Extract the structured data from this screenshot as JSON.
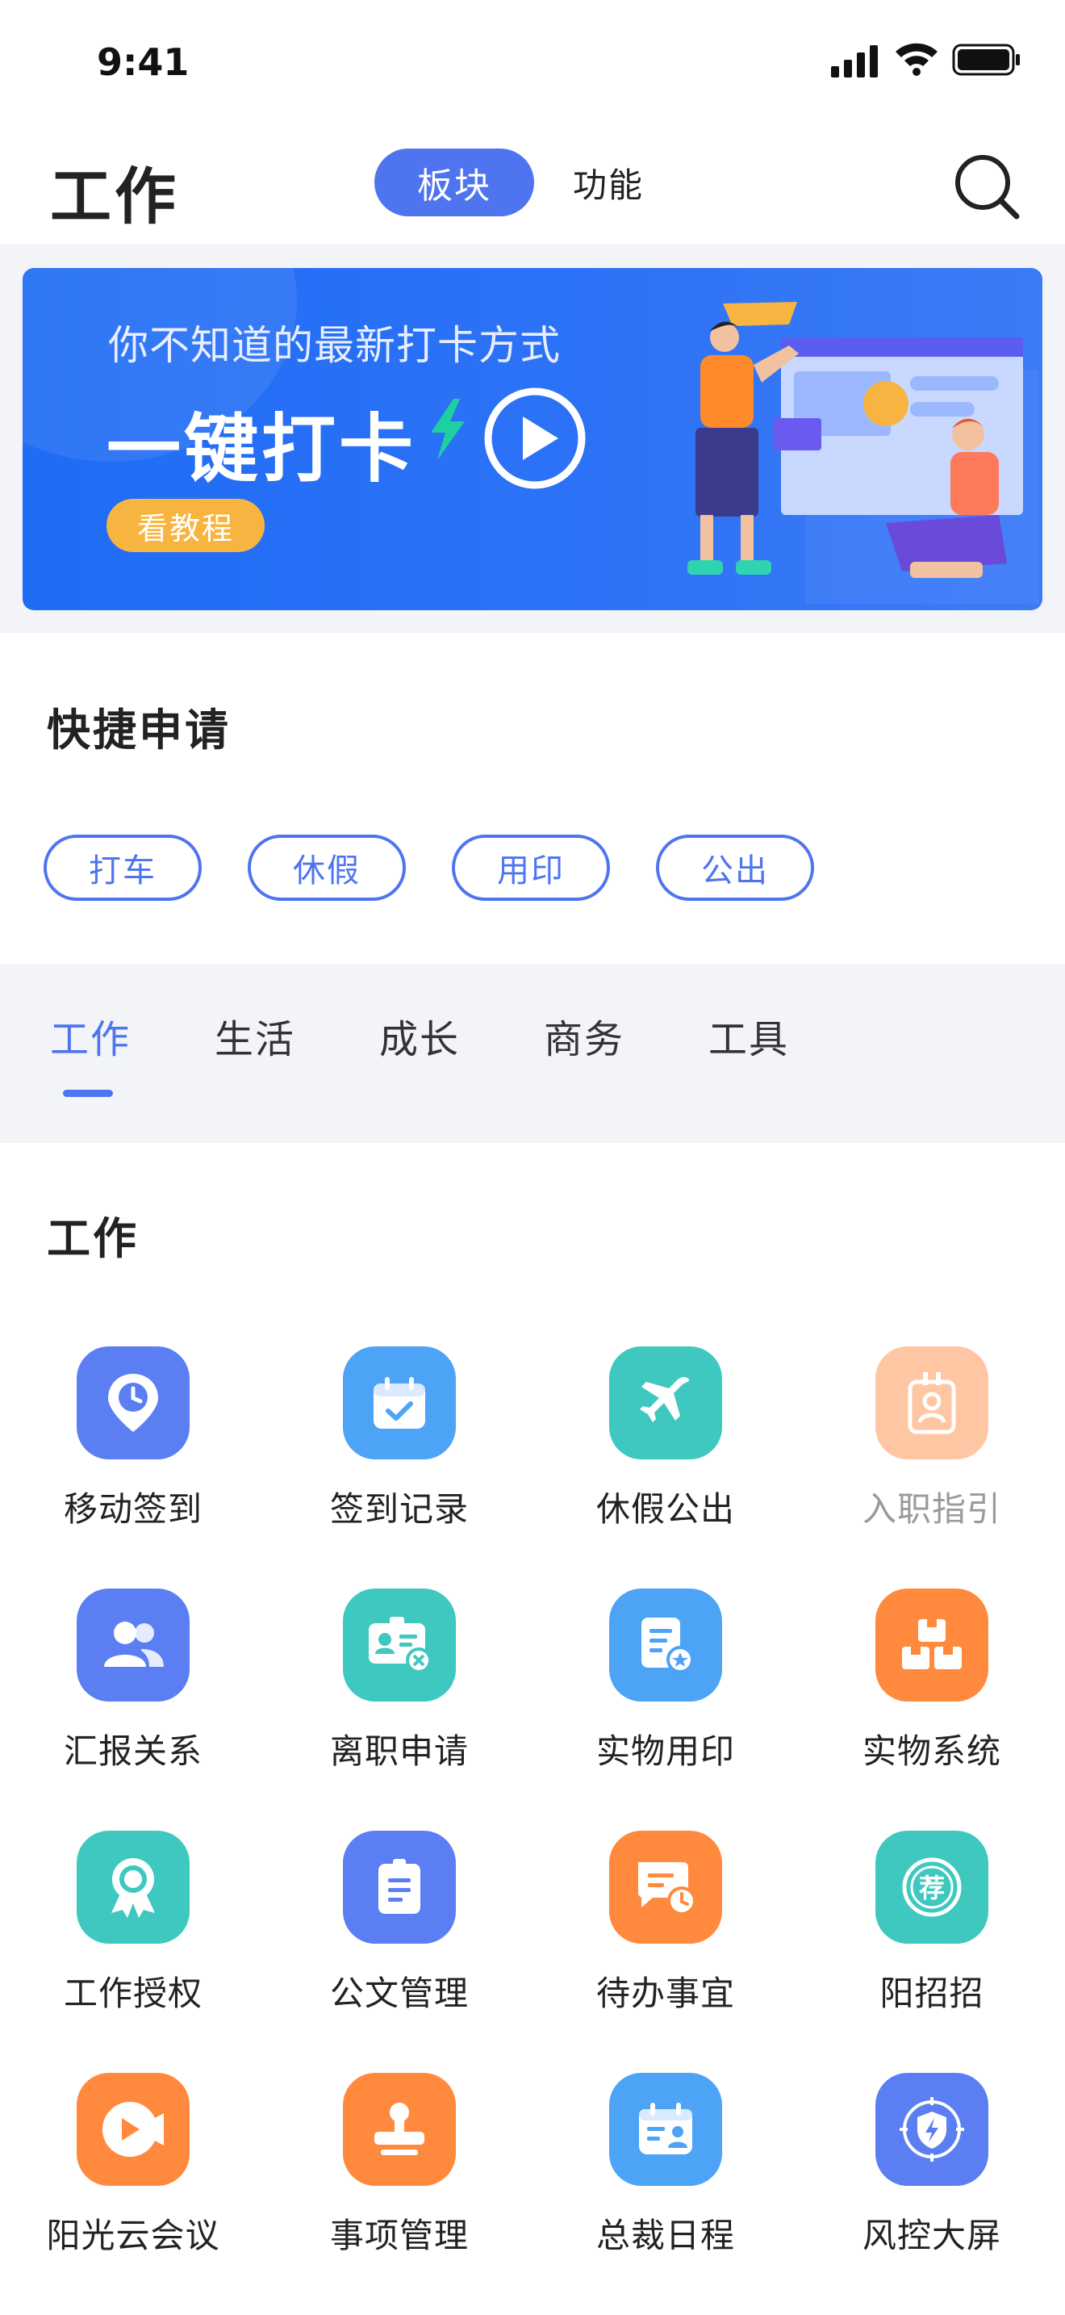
{
  "status_bar": {
    "time": "9:41"
  },
  "header": {
    "title": "工作",
    "segments": [
      {
        "label": "板块",
        "active": true
      },
      {
        "label": "功能",
        "active": false
      }
    ]
  },
  "banner": {
    "subtitle": "你不知道的最新打卡方式",
    "headline": "一键打卡",
    "button": "看教程",
    "colors": {
      "background": "#1f6cf5",
      "button": "#f7b440",
      "bolt": "#1ecfa0"
    }
  },
  "quick_apply": {
    "title": "快捷申请",
    "items": [
      "打车",
      "休假",
      "用印",
      "公出"
    ]
  },
  "category_tabs": {
    "items": [
      {
        "label": "工作",
        "active": true
      },
      {
        "label": "生活",
        "active": false
      },
      {
        "label": "成长",
        "active": false
      },
      {
        "label": "商务",
        "active": false
      },
      {
        "label": "工具",
        "active": false
      }
    ]
  },
  "work_section": {
    "title": "工作",
    "apps": [
      {
        "label": "移动签到",
        "icon": "location-clock-icon",
        "color": "#5b7ff2"
      },
      {
        "label": "签到记录",
        "icon": "calendar-check-icon",
        "color": "#4da3f5"
      },
      {
        "label": "休假公出",
        "icon": "airplane-icon",
        "color": "#3ec8c0"
      },
      {
        "label": "入职指引",
        "icon": "badge-person-icon",
        "color": "#ffc6a3",
        "muted": true
      },
      {
        "label": "汇报关系",
        "icon": "people-icon",
        "color": "#5b7ff2"
      },
      {
        "label": "离职申请",
        "icon": "id-card-cancel-icon",
        "color": "#3ec8c0"
      },
      {
        "label": "实物用印",
        "icon": "document-seal-icon",
        "color": "#4da3f5"
      },
      {
        "label": "实物系统",
        "icon": "boxes-icon",
        "color": "#ff8a3d"
      },
      {
        "label": "工作授权",
        "icon": "award-ribbon-icon",
        "color": "#3ec8c0"
      },
      {
        "label": "公文管理",
        "icon": "document-icon",
        "color": "#5b7ff2"
      },
      {
        "label": "待办事宜",
        "icon": "message-clock-icon",
        "color": "#ff8a3d"
      },
      {
        "label": "阳招招",
        "icon": "recommend-icon",
        "color": "#3ec8c0",
        "badge_char": "荐"
      },
      {
        "label": "阳光云会议",
        "icon": "video-camera-icon",
        "color": "#ff8a3d"
      },
      {
        "label": "事项管理",
        "icon": "stamp-icon",
        "color": "#ff8a3d"
      },
      {
        "label": "总裁日程",
        "icon": "calendar-person-icon",
        "color": "#4da3f5"
      },
      {
        "label": "风控大屏",
        "icon": "shield-bolt-icon",
        "color": "#5b7ff2"
      }
    ]
  }
}
